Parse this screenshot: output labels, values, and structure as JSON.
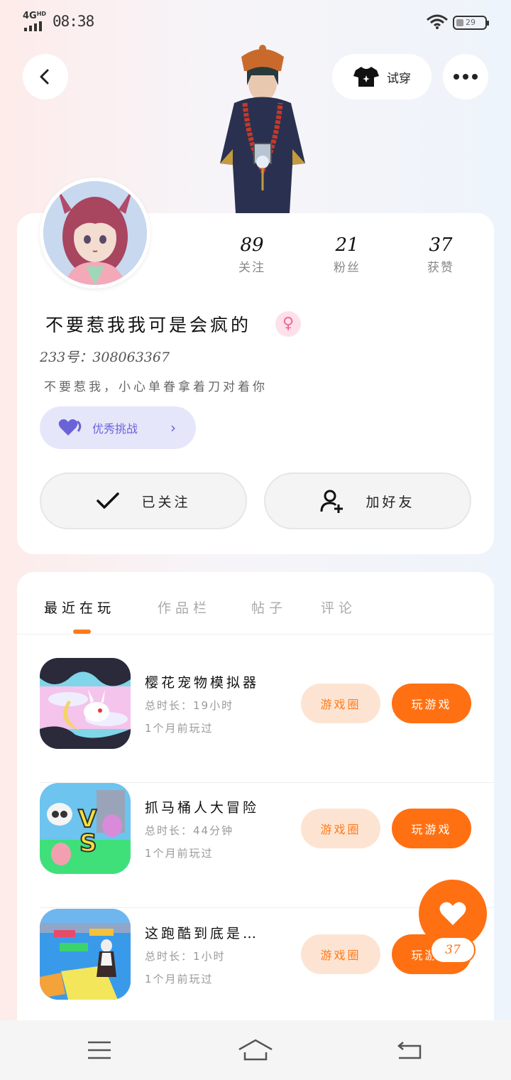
{
  "status_bar": {
    "network": "4G",
    "network_sup": "HD",
    "time": "08:38",
    "battery": "29"
  },
  "header": {
    "try_on_label": "试穿"
  },
  "profile": {
    "stats": [
      {
        "value": "89",
        "label": "关注"
      },
      {
        "value": "21",
        "label": "粉丝"
      },
      {
        "value": "37",
        "label": "获赞"
      }
    ],
    "username": "不要惹我我可是会疯的",
    "user_id": "233号：308063367",
    "bio": "不要惹我，小心单眷拿着刀对着你",
    "excellent_label": "优秀挑战",
    "follow_label": "已关注",
    "add_friend_label": "加好友"
  },
  "tabs": [
    {
      "label": "最近在玩",
      "active": true
    },
    {
      "label": "作品栏",
      "active": false
    },
    {
      "label": "帖子",
      "active": false
    },
    {
      "label": "评论",
      "active": false
    }
  ],
  "games": [
    {
      "title": "樱花宠物模拟器",
      "duration": "总时长：19小时",
      "played": "1个月前玩过",
      "hall_label": "游戏圈",
      "play_label": "玩游戏"
    },
    {
      "title": "抓马桶人大冒险",
      "duration": "总时长：44分钟",
      "played": "1个月前玩过",
      "hall_label": "游戏圈",
      "play_label": "玩游戏"
    },
    {
      "title": "这跑酷到底是…",
      "duration": "总时长：1小时",
      "played": "1个月前玩过",
      "hall_label": "游戏圈",
      "play_label": "玩游戏"
    }
  ],
  "like": {
    "count": "37"
  },
  "colors": {
    "accent": "#ff7012",
    "accent_soft": "#fde4d2",
    "excellent": "#6a63d8"
  }
}
